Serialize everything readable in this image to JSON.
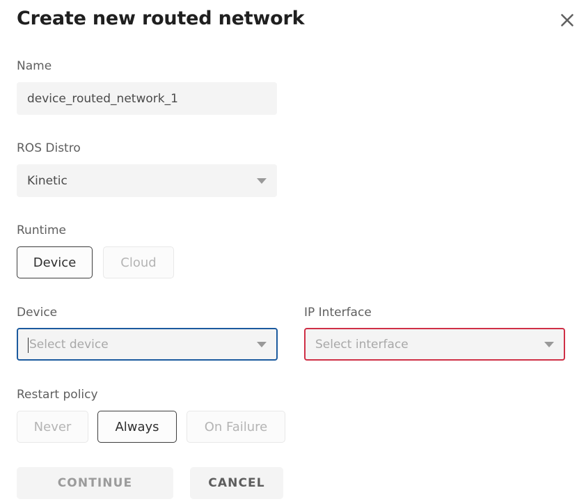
{
  "dialog": {
    "title": "Create new routed network",
    "close_icon": "close-icon"
  },
  "fields": {
    "name": {
      "label": "Name",
      "value": "device_routed_network_1",
      "placeholder": "Name"
    },
    "ros_distro": {
      "label": "ROS Distro",
      "value": "Kinetic"
    },
    "runtime": {
      "label": "Runtime",
      "options": [
        {
          "label": "Device",
          "selected": true
        },
        {
          "label": "Cloud",
          "selected": false
        }
      ]
    },
    "device": {
      "label": "Device",
      "value": "",
      "placeholder": "Select device",
      "state": "focused"
    },
    "ip_interface": {
      "label": "IP Interface",
      "value": "",
      "placeholder": "Select interface",
      "state": "error"
    },
    "restart_policy": {
      "label": "Restart policy",
      "options": [
        {
          "label": "Never",
          "selected": false
        },
        {
          "label": "Always",
          "selected": true
        },
        {
          "label": "On Failure",
          "selected": false
        }
      ]
    }
  },
  "actions": {
    "continue_label": "CONTINUE",
    "cancel_label": "CANCEL"
  },
  "colors": {
    "focus_border": "#1b5a9e",
    "error_border": "#cf2f46",
    "field_background": "#f4f4f4",
    "title_text": "#1f1f1f",
    "label_text": "#5e5e5e",
    "placeholder_text": "#a8a8a8"
  }
}
